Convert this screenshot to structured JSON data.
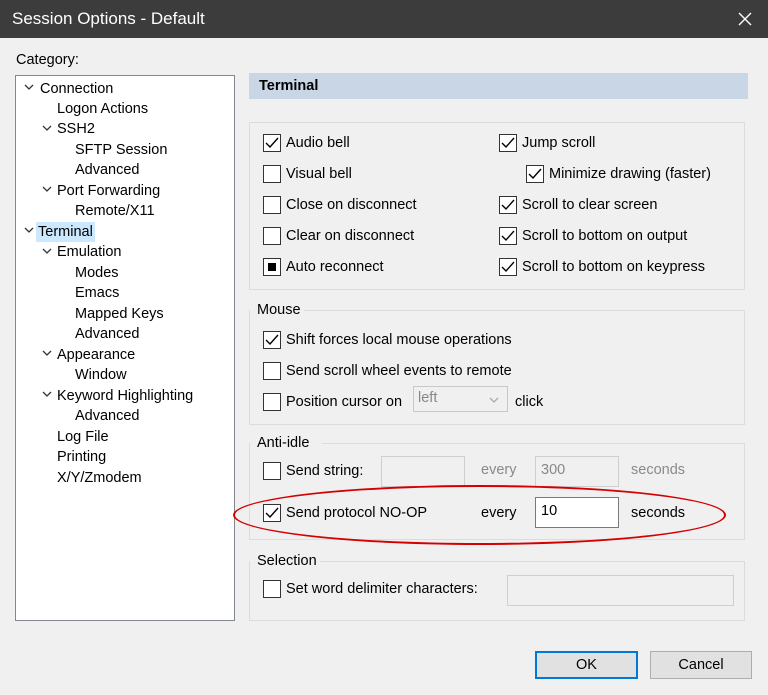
{
  "window": {
    "title": "Session Options - Default"
  },
  "category": {
    "label": "Category:",
    "tree": [
      {
        "label": "Connection"
      },
      {
        "label": "Logon Actions"
      },
      {
        "label": "SSH2"
      },
      {
        "label": "SFTP Session"
      },
      {
        "label": "Advanced"
      },
      {
        "label": "Port Forwarding"
      },
      {
        "label": "Remote/X11"
      },
      {
        "label": "Terminal",
        "selected": true
      },
      {
        "label": "Emulation"
      },
      {
        "label": "Modes"
      },
      {
        "label": "Emacs"
      },
      {
        "label": "Mapped Keys"
      },
      {
        "label": "Advanced"
      },
      {
        "label": "Appearance"
      },
      {
        "label": "Window"
      },
      {
        "label": "Keyword Highlighting"
      },
      {
        "label": "Advanced"
      },
      {
        "label": "Log File"
      },
      {
        "label": "Printing"
      },
      {
        "label": "X/Y/Zmodem"
      }
    ]
  },
  "panel": {
    "header": "Terminal"
  },
  "general": {
    "audio_bell": {
      "label": "Audio bell",
      "checked": true
    },
    "visual_bell": {
      "label": "Visual bell",
      "checked": false
    },
    "close_on_disconnect": {
      "label": "Close on disconnect",
      "checked": false
    },
    "clear_on_disconnect": {
      "label": "Clear on disconnect",
      "checked": false
    },
    "auto_reconnect": {
      "label": "Auto reconnect",
      "state": "indeterminate"
    },
    "jump_scroll": {
      "label": "Jump scroll",
      "checked": true
    },
    "minimize_drawing": {
      "label": "Minimize drawing (faster)",
      "checked": true
    },
    "scroll_clear_screen": {
      "label": "Scroll to clear screen",
      "checked": true
    },
    "scroll_bottom_output": {
      "label": "Scroll to bottom on output",
      "checked": true
    },
    "scroll_bottom_keypress": {
      "label": "Scroll to bottom on keypress",
      "checked": true
    }
  },
  "mouse": {
    "label": "Mouse",
    "shift_forces": {
      "label": "Shift forces local mouse operations",
      "checked": true
    },
    "scroll_wheel": {
      "label": "Send scroll wheel events to remote",
      "checked": false
    },
    "position_cursor": {
      "label": "Position cursor on",
      "checked": false
    },
    "position_select": "left",
    "click_label": "click"
  },
  "anti_idle": {
    "label": "Anti-idle",
    "send_string": {
      "label": "Send string:",
      "checked": false
    },
    "send_string_value": "",
    "every_label_1": "every",
    "interval_1": "300",
    "seconds_label_1": "seconds",
    "send_noop": {
      "label": "Send protocol NO-OP",
      "checked": true
    },
    "every_label_2": "every",
    "interval_2": "10",
    "seconds_label_2": "seconds"
  },
  "selection": {
    "label": "Selection",
    "word_delim": {
      "label": "Set word delimiter characters:",
      "checked": false
    },
    "word_delim_value": ""
  },
  "buttons": {
    "ok": "OK",
    "cancel": "Cancel"
  },
  "colors": {
    "highlight_ellipse": "#d40000",
    "selected_item": "#cce8ff",
    "header_bg": "#c8d6e6"
  }
}
